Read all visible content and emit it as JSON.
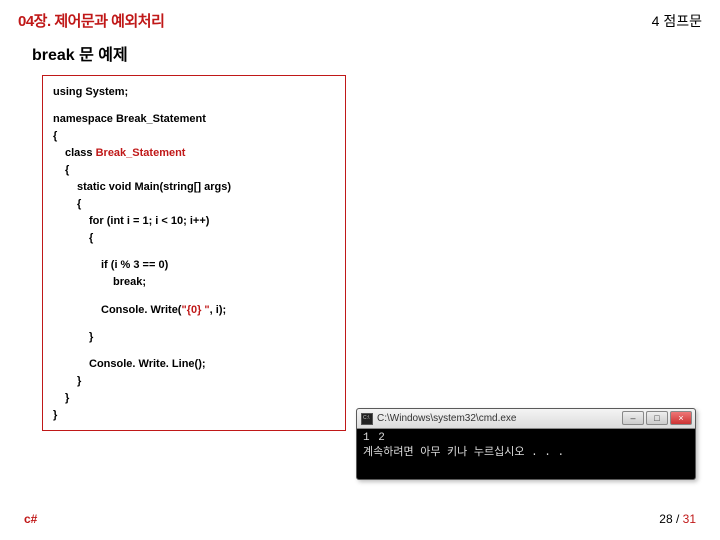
{
  "header": {
    "chapter": "04장. 제어문과 예외처리",
    "section": "4 점프문"
  },
  "title": "break 문 예제",
  "code": {
    "l1": "using System;",
    "l2": "namespace Break_Statement",
    "l3": "{",
    "l4": "class ",
    "l4b": "Break_Statement",
    "l5": "{",
    "l6": "static void Main(string[] args)",
    "l7": "{",
    "l8": "for (int i = 1; i < 10; i++)",
    "l9": "{",
    "l10": "if (i % 3 == 0)",
    "l11": "break;",
    "l12a": "Console. Write(",
    "l12b": "\"{0} \"",
    "l12c": ", i);",
    "l13": "}",
    "l14": "Console. Write. Line();",
    "l15": "}",
    "l16": "}",
    "l17": "}"
  },
  "console": {
    "title": "C:\\Windows\\system32\\cmd.exe",
    "line1": "1 2",
    "line2": "계속하려면 아무 키나 누르십시오 . . ."
  },
  "footer": {
    "lang": "c#",
    "page_current": "28",
    "page_sep": " / ",
    "page_total": "31"
  }
}
